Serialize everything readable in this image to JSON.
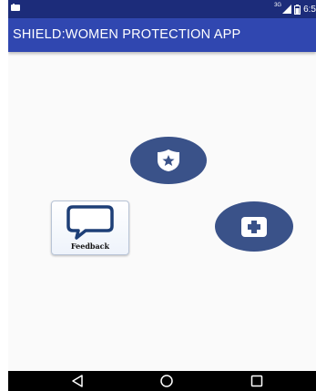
{
  "status_bar": {
    "network_type": "3G",
    "time": "6:5",
    "left_icon": "notification-icon",
    "signal_icon": "signal-icon",
    "battery_icon": "battery-icon"
  },
  "app_bar": {
    "title": "SHIELD:WOMEN PROTECTION APP"
  },
  "main": {
    "police_button": {
      "icon": "police-badge-icon"
    },
    "feedback_button": {
      "icon": "speech-bubble-icon",
      "label": "Feedback"
    },
    "medical_button": {
      "icon": "medical-cross-icon"
    }
  },
  "nav_bar": {
    "back_icon": "back-icon",
    "home_icon": "home-icon",
    "recents_icon": "recents-icon"
  },
  "colors": {
    "status_bar": "#1c2c7a",
    "app_bar": "#3047b0",
    "round_button": "#3a5289",
    "background": "#fafafa"
  }
}
